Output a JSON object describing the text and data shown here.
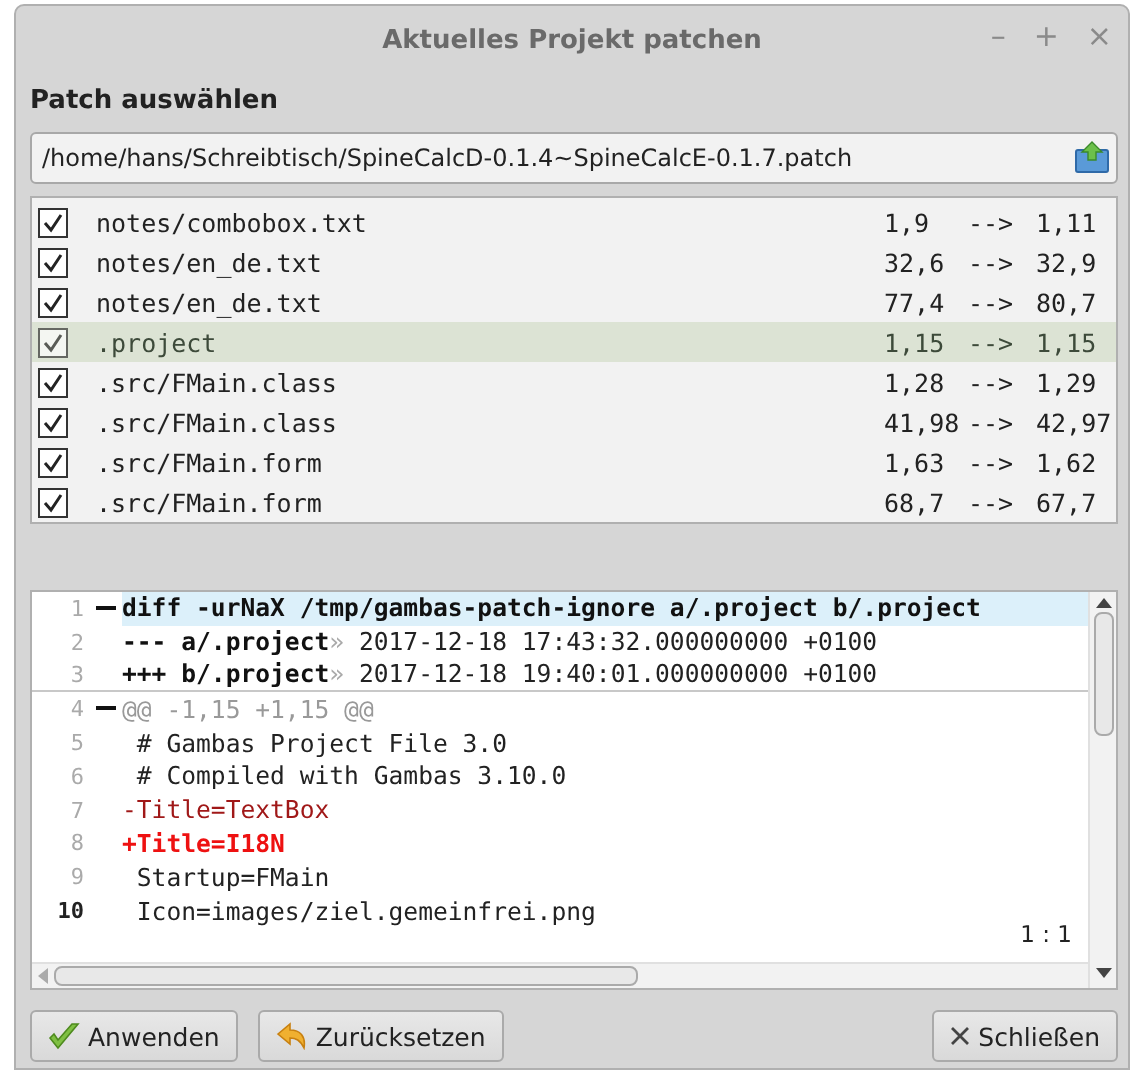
{
  "window": {
    "title": "Aktuelles Projekt patchen",
    "controls": [
      "–",
      "+",
      "×"
    ]
  },
  "section_title": "Patch auswählen",
  "patch_path": {
    "value": "/home/hans/Schreibtisch/SpineCalcD-0.1.4~SpineCalcE-0.1.7.patch"
  },
  "hunks": [
    {
      "file": "notes/combobox.txt",
      "from": "1,9",
      "arrow": "-->",
      "to": "1,11",
      "checked": true,
      "selected": false
    },
    {
      "file": "notes/en_de.txt",
      "from": "32,6",
      "arrow": "-->",
      "to": "32,9",
      "checked": true,
      "selected": false
    },
    {
      "file": "notes/en_de.txt",
      "from": "77,4",
      "arrow": "-->",
      "to": "80,7",
      "checked": true,
      "selected": false
    },
    {
      "file": ".project",
      "from": "1,15",
      "arrow": "-->",
      "to": "1,15",
      "checked": true,
      "selected": true
    },
    {
      "file": ".src/FMain.class",
      "from": "1,28",
      "arrow": "-->",
      "to": "1,29",
      "checked": true,
      "selected": false
    },
    {
      "file": ".src/FMain.class",
      "from": "41,98",
      "arrow": "-->",
      "to": "42,97",
      "checked": true,
      "selected": false
    },
    {
      "file": ".src/FMain.form",
      "from": "1,63",
      "arrow": "-->",
      "to": "1,62",
      "checked": true,
      "selected": false
    },
    {
      "file": ".src/FMain.form",
      "from": "68,7",
      "arrow": "-->",
      "to": "67,7",
      "checked": true,
      "selected": false
    }
  ],
  "editor": {
    "cursor": "1 : 1",
    "lines": [
      {
        "number": "1",
        "current": false,
        "fold": true,
        "highlight": true,
        "separator": false,
        "segments": [
          {
            "kind": "header",
            "text": "diff -urNaX /tmp/gambas-patch-ignore a/.project b/.project"
          }
        ]
      },
      {
        "number": "2",
        "current": false,
        "fold": false,
        "highlight": false,
        "separator": false,
        "segments": [
          {
            "kind": "header",
            "text": "--- a/.project"
          },
          {
            "kind": "tab",
            "text": "»"
          },
          {
            "kind": "context",
            "text": " 2017-12-18 17:43:32.000000000 +0100"
          }
        ]
      },
      {
        "number": "3",
        "current": false,
        "fold": false,
        "highlight": false,
        "separator": true,
        "segments": [
          {
            "kind": "header",
            "text": "+++ b/.project"
          },
          {
            "kind": "tab",
            "text": "»"
          },
          {
            "kind": "context",
            "text": " 2017-12-18 19:40:01.000000000 +0100"
          }
        ]
      },
      {
        "number": "4",
        "current": false,
        "fold": true,
        "highlight": false,
        "separator": false,
        "segments": [
          {
            "kind": "hunk",
            "text": "@@ -1,15 +1,15 @@"
          }
        ]
      },
      {
        "number": "5",
        "current": false,
        "fold": false,
        "highlight": false,
        "separator": false,
        "segments": [
          {
            "kind": "context",
            "text": " # Gambas Project File 3.0"
          }
        ]
      },
      {
        "number": "6",
        "current": false,
        "fold": false,
        "highlight": false,
        "separator": false,
        "segments": [
          {
            "kind": "context",
            "text": " # Compiled with Gambas 3.10.0"
          }
        ]
      },
      {
        "number": "7",
        "current": false,
        "fold": false,
        "highlight": false,
        "separator": false,
        "segments": [
          {
            "kind": "removed",
            "text": "-Title=TextBox"
          }
        ]
      },
      {
        "number": "8",
        "current": false,
        "fold": false,
        "highlight": false,
        "separator": false,
        "segments": [
          {
            "kind": "added",
            "text": "+Title=I18N"
          }
        ]
      },
      {
        "number": "9",
        "current": false,
        "fold": false,
        "highlight": false,
        "separator": false,
        "segments": [
          {
            "kind": "context",
            "text": " Startup=FMain"
          }
        ]
      },
      {
        "number": "10",
        "current": true,
        "fold": false,
        "highlight": false,
        "separator": false,
        "segments": [
          {
            "kind": "context",
            "text": " Icon=images/ziel.gemeinfrei.png"
          }
        ]
      }
    ]
  },
  "buttons": [
    {
      "kind": "apply",
      "label": "Anwenden"
    },
    {
      "kind": "reset",
      "label": "Zurücksetzen"
    },
    {
      "kind": "close",
      "label": "Schließen"
    }
  ]
}
